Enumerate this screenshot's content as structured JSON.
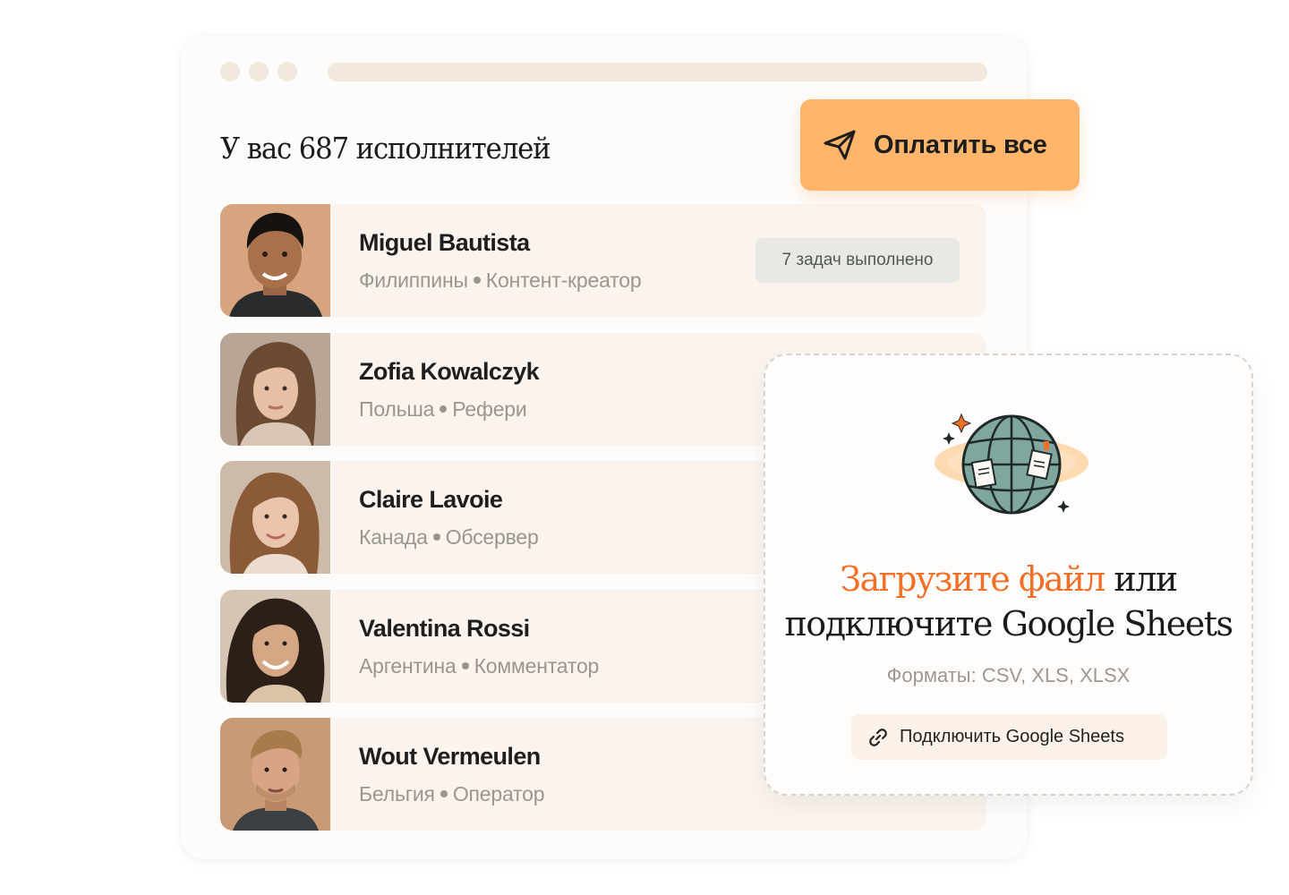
{
  "header": {
    "title": "У вас 687 исполнителей",
    "pay_button_label": "Оплатить все"
  },
  "contractors": [
    {
      "name": "Miguel Bautista",
      "country": "Филиппины",
      "role": "Контент-креатор",
      "badge": "7 задач выполнено"
    },
    {
      "name": "Zofia Kowalczyk",
      "country": "Польша",
      "role": "Рефери"
    },
    {
      "name": "Claire Lavoie",
      "country": "Канада",
      "role": "Обсервер"
    },
    {
      "name": "Valentina Rossi",
      "country": "Аргентина",
      "role": "Комментатор"
    },
    {
      "name": "Wout Vermeulen",
      "country": "Бельгия",
      "role": "Оператор"
    }
  ],
  "upload": {
    "title_accent": "Загрузите файл",
    "title_rest_1": " или",
    "title_rest_2": "подключите Google Sheets",
    "formats": "Форматы: CSV, XLS, XLSX",
    "connect_button_label": "Подключить Google Sheets"
  },
  "colors": {
    "accent_orange": "#ffb56a",
    "accent_text": "#f26f27",
    "row_bg": "#fbf4ee",
    "chrome": "#f3e8dc"
  }
}
